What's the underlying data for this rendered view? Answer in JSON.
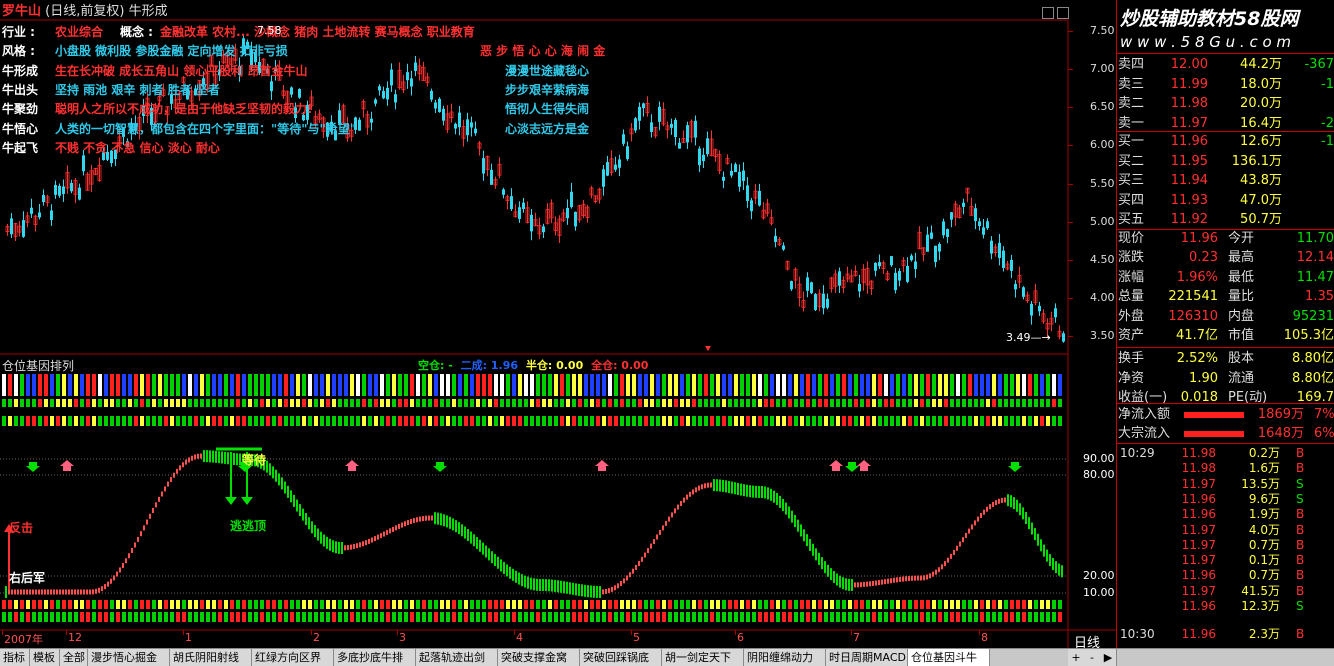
{
  "window": {
    "title_name": "罗牛山",
    "title_mode": "(日线,前复权)",
    "title_indicator": "牛形成",
    "watermark_main": "炒股辅助教材58股网",
    "watermark_url": "w w w . 5 8 G u . c o m",
    "high_marker": "7.58",
    "low_marker": "3.49"
  },
  "info_rows": [
    {
      "label": "行业 :",
      "text1": "农业综合",
      "label2": "概念 :",
      "text2": "金融改革 农村... 沙概念 猪肉 土地流转 赛马概念 职业教育",
      "color": "#ff3030"
    },
    {
      "label": "风格 :",
      "text1": "小盘股 微利股 参股金融 定向增发 扣非亏损",
      "text_right": "恶 步 悟 心 心 海 闹 金",
      "color": "#30c8e8",
      "right_color": "#ff3030"
    },
    {
      "label": "牛形成",
      "text1": "生在长冲破 成长五角山 领心平股利 昂首金牛山",
      "text_right": "漫漫世途藏毯心",
      "color": "#ff3030",
      "right_color": "#30c8e8"
    },
    {
      "label": "牛出头",
      "text1": "坚持 雨池 艰辛 刺者 胜者 坚者",
      "text_right": "步步艰辛萦病海",
      "color": "#30c8e8",
      "right_color": "#30c8e8"
    },
    {
      "label": "牛聚劲",
      "text1": "聪明人之所以不成功，是由于他缺乏坚韧的毅力!",
      "text_right": "悟彻人生得失闹",
      "color": "#ff3030",
      "right_color": "#30c8e8"
    },
    {
      "label": "牛悟心",
      "text1": "人类的一切智慧，都包含在四个字里面：\"等待\"与\"希望\"",
      "text_right": "心淡志远方是金",
      "color": "#30c8e8",
      "right_color": "#30c8e8"
    },
    {
      "label": "牛起飞",
      "text1": "不贱 不贪 不急 信心 淡心 耐心",
      "color": "#ff3030"
    }
  ],
  "price_axis": [
    "7.50",
    "7.00",
    "6.50",
    "6.00",
    "5.50",
    "5.00",
    "4.50",
    "4.00",
    "3.50"
  ],
  "indicator": {
    "name": "仓位基因排列",
    "kong": "空仓: -",
    "erbei": "二成: 1.96",
    "banca": "半仓: 0.00",
    "quancang": "全仓: 0.00",
    "axis": [
      "90.00",
      "80.00",
      "20.00",
      "10.00"
    ],
    "label_xiaoshou": "等待",
    "label_taoding": "逃顶",
    "label_tanshi": "反击",
    "label_youhoujun": "右后军"
  },
  "date_axis": {
    "labels": [
      "2007年",
      "12",
      "1",
      "2",
      "3",
      "4",
      "5",
      "6",
      "7",
      "8"
    ],
    "period": "日线"
  },
  "quotes_sell": [
    {
      "label": "卖四",
      "price": "12.00",
      "vol": "44.2万",
      "chg": "-367"
    },
    {
      "label": "卖三",
      "price": "11.99",
      "vol": "18.0万",
      "chg": "-1"
    },
    {
      "label": "卖二",
      "price": "11.98",
      "vol": "20.0万",
      "chg": ""
    },
    {
      "label": "卖一",
      "price": "11.97",
      "vol": "16.4万",
      "chg": "-2"
    }
  ],
  "quotes_buy": [
    {
      "label": "买一",
      "price": "11.96",
      "vol": "12.6万",
      "chg": "-1"
    },
    {
      "label": "买二",
      "price": "11.95",
      "vol": "136.1万",
      "chg": ""
    },
    {
      "label": "买三",
      "price": "11.94",
      "vol": "43.8万",
      "chg": ""
    },
    {
      "label": "买四",
      "price": "11.93",
      "vol": "47.0万",
      "chg": ""
    },
    {
      "label": "买五",
      "price": "11.92",
      "vol": "50.7万",
      "chg": ""
    }
  ],
  "stats": [
    {
      "l1": "现价",
      "v1": "11.96",
      "c1": "#ff3030",
      "l2": "今开",
      "v2": "11.70",
      "c2": "#00e000"
    },
    {
      "l1": "涨跌",
      "v1": "0.23",
      "c1": "#ff3030",
      "l2": "最高",
      "v2": "12.14",
      "c2": "#ff3030"
    },
    {
      "l1": "涨幅",
      "v1": "1.96%",
      "c1": "#ff3030",
      "l2": "最低",
      "v2": "11.47",
      "c2": "#00e000"
    },
    {
      "l1": "总量",
      "v1": "221541",
      "c1": "#ffff40",
      "l2": "量比",
      "v2": "1.35",
      "c2": "#ff3030"
    },
    {
      "l1": "外盘",
      "v1": "126310",
      "c1": "#ff3030",
      "l2": "内盘",
      "v2": "95231",
      "c2": "#00e000"
    },
    {
      "l1": "资产",
      "v1": "41.7亿",
      "c1": "#ffff40",
      "l2": "市值",
      "v2": "105.3亿",
      "c2": "#ffff40"
    },
    {
      "l1": "换手",
      "v1": "2.52%",
      "c1": "#ffff40",
      "l2": "股本",
      "v2": "8.80亿",
      "c2": "#ffff40"
    },
    {
      "l1": "净资",
      "v1": "1.90",
      "c1": "#ffff40",
      "l2": "流通",
      "v2": "8.80亿",
      "c2": "#ffff40"
    },
    {
      "l1": "收益(一)",
      "v1": "0.018",
      "c1": "#ffff40",
      "l2": "PE(动)",
      "v2": "169.7",
      "c2": "#ffff40"
    }
  ],
  "flows": [
    {
      "label": "净流入额",
      "value": "1869万",
      "pct": "7%"
    },
    {
      "label": "大宗流入",
      "value": "1648万",
      "pct": "6%"
    }
  ],
  "ticks": [
    {
      "time": "10:29",
      "price": "11.98",
      "vol": "0.2万",
      "bs": "B"
    },
    {
      "time": "",
      "price": "11.98",
      "vol": "1.6万",
      "bs": "B"
    },
    {
      "time": "",
      "price": "11.97",
      "vol": "13.5万",
      "bs": "S"
    },
    {
      "time": "",
      "price": "11.96",
      "vol": "9.6万",
      "bs": "S"
    },
    {
      "time": "",
      "price": "11.96",
      "vol": "1.9万",
      "bs": "B"
    },
    {
      "time": "",
      "price": "11.97",
      "vol": "4.0万",
      "bs": "B"
    },
    {
      "time": "",
      "price": "11.97",
      "vol": "0.7万",
      "bs": "B"
    },
    {
      "time": "",
      "price": "11.97",
      "vol": "0.1万",
      "bs": "B"
    },
    {
      "time": "",
      "price": "11.96",
      "vol": "0.7万",
      "bs": "B"
    },
    {
      "time": "",
      "price": "11.97",
      "vol": "41.5万",
      "bs": "B"
    },
    {
      "time": "",
      "price": "11.96",
      "vol": "12.3万",
      "bs": "S"
    },
    {
      "time": "10:30",
      "price": "11.96",
      "vol": "2.3万",
      "bs": "B"
    }
  ],
  "tabs": [
    "指标",
    "模板",
    "全部",
    "漫步悟心掘金",
    "胡氏阴阳射线",
    "红绿方向区界",
    "多底抄底牛排",
    "起落轨迹出剑",
    "突破支撑金窝",
    "突破回踩锅底",
    "胡一剑定天下",
    "阴阳缠绵动力",
    "时日周期MACD",
    "仓位基因斗牛"
  ],
  "nav": [
    "+",
    "-",
    "▶"
  ],
  "colors": {
    "red": "#ff3030",
    "cyan": "#30c8e8",
    "green": "#00e000",
    "yellow": "#ffff40",
    "blue": "#2040ff",
    "grid": "#a00000"
  }
}
